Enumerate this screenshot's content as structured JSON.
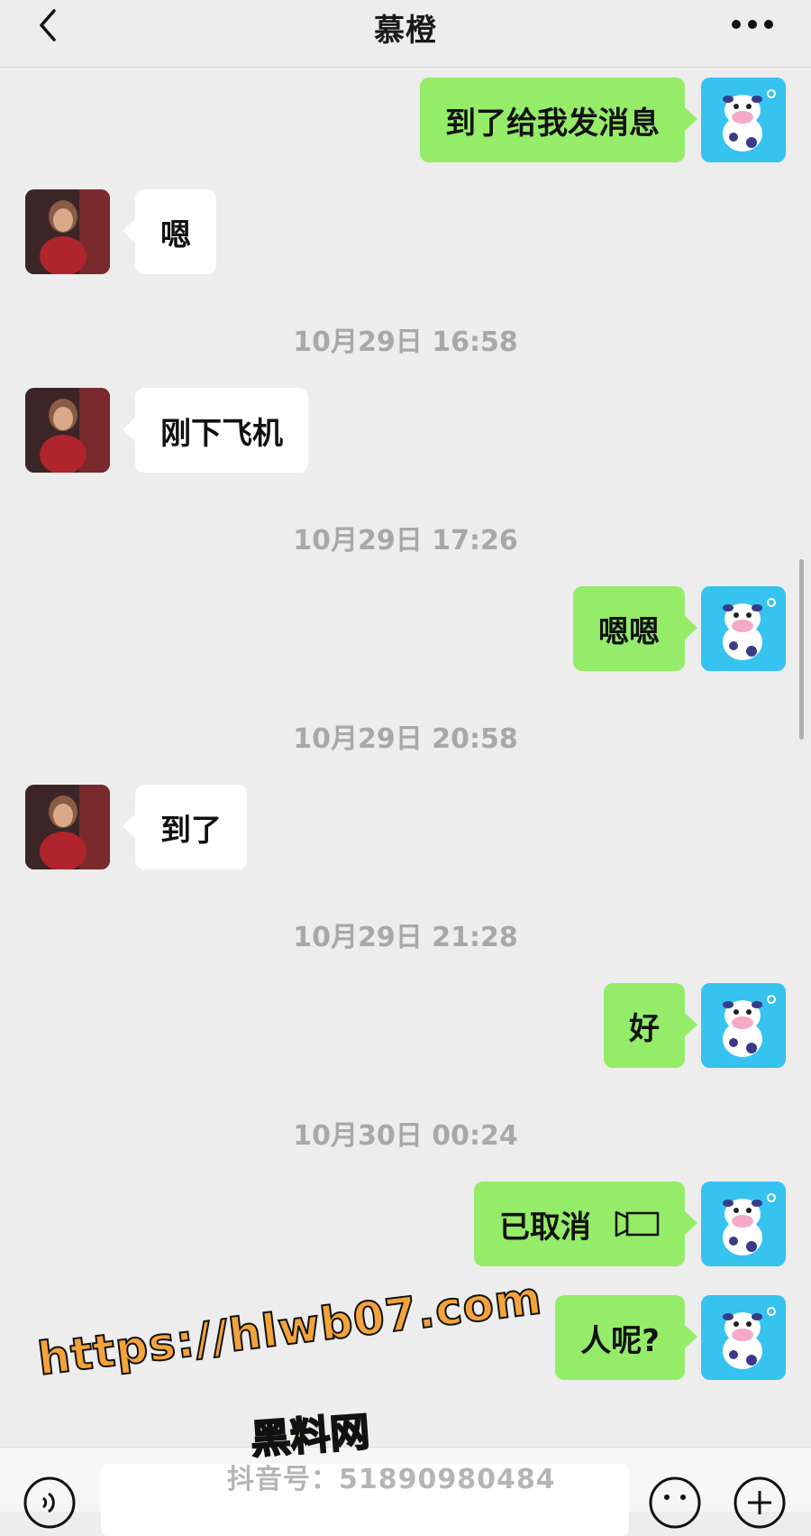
{
  "header": {
    "title": "慕橙",
    "back_icon": "chevron-left-icon",
    "more_icon": "more-dots-icon"
  },
  "messages": [
    {
      "side": "self",
      "text": "到了给我发消息"
    },
    {
      "side": "other",
      "text": "嗯"
    },
    {
      "timestamp": "10月29日 16:58"
    },
    {
      "side": "other",
      "text": "刚下飞机"
    },
    {
      "timestamp": "10月29日 17:26"
    },
    {
      "side": "self",
      "text": "嗯嗯"
    },
    {
      "timestamp": "10月29日 20:58"
    },
    {
      "side": "other",
      "text": "到了"
    },
    {
      "timestamp": "10月29日 21:28"
    },
    {
      "side": "self",
      "text": "好"
    },
    {
      "timestamp": "10月30日 00:24"
    },
    {
      "side": "self",
      "text": "已取消",
      "icon": "video-call-icon"
    },
    {
      "side": "self",
      "text": "人呢?"
    }
  ],
  "watermark": {
    "url": "https://hlwb07.com",
    "name": "黑料网",
    "douyin": "抖音号：51890980484"
  },
  "colors": {
    "self_bubble": "#95ec69",
    "other_bubble": "#ffffff",
    "background": "#ededed",
    "self_avatar": "#36c3ef"
  }
}
